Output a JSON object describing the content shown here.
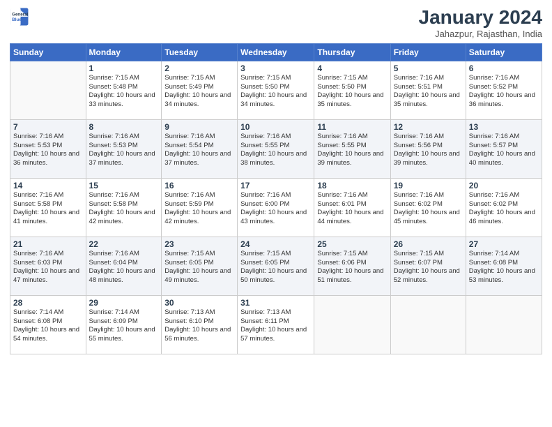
{
  "logo": {
    "line1": "General",
    "line2": "Blue"
  },
  "title": "January 2024",
  "location": "Jahazpur, Rajasthan, India",
  "weekdays": [
    "Sunday",
    "Monday",
    "Tuesday",
    "Wednesday",
    "Thursday",
    "Friday",
    "Saturday"
  ],
  "weeks": [
    [
      {
        "day": "",
        "sunrise": "",
        "sunset": "",
        "daylight": ""
      },
      {
        "day": "1",
        "sunrise": "Sunrise: 7:15 AM",
        "sunset": "Sunset: 5:48 PM",
        "daylight": "Daylight: 10 hours and 33 minutes."
      },
      {
        "day": "2",
        "sunrise": "Sunrise: 7:15 AM",
        "sunset": "Sunset: 5:49 PM",
        "daylight": "Daylight: 10 hours and 34 minutes."
      },
      {
        "day": "3",
        "sunrise": "Sunrise: 7:15 AM",
        "sunset": "Sunset: 5:50 PM",
        "daylight": "Daylight: 10 hours and 34 minutes."
      },
      {
        "day": "4",
        "sunrise": "Sunrise: 7:15 AM",
        "sunset": "Sunset: 5:50 PM",
        "daylight": "Daylight: 10 hours and 35 minutes."
      },
      {
        "day": "5",
        "sunrise": "Sunrise: 7:16 AM",
        "sunset": "Sunset: 5:51 PM",
        "daylight": "Daylight: 10 hours and 35 minutes."
      },
      {
        "day": "6",
        "sunrise": "Sunrise: 7:16 AM",
        "sunset": "Sunset: 5:52 PM",
        "daylight": "Daylight: 10 hours and 36 minutes."
      }
    ],
    [
      {
        "day": "7",
        "sunrise": "Sunrise: 7:16 AM",
        "sunset": "Sunset: 5:53 PM",
        "daylight": "Daylight: 10 hours and 36 minutes."
      },
      {
        "day": "8",
        "sunrise": "Sunrise: 7:16 AM",
        "sunset": "Sunset: 5:53 PM",
        "daylight": "Daylight: 10 hours and 37 minutes."
      },
      {
        "day": "9",
        "sunrise": "Sunrise: 7:16 AM",
        "sunset": "Sunset: 5:54 PM",
        "daylight": "Daylight: 10 hours and 37 minutes."
      },
      {
        "day": "10",
        "sunrise": "Sunrise: 7:16 AM",
        "sunset": "Sunset: 5:55 PM",
        "daylight": "Daylight: 10 hours and 38 minutes."
      },
      {
        "day": "11",
        "sunrise": "Sunrise: 7:16 AM",
        "sunset": "Sunset: 5:55 PM",
        "daylight": "Daylight: 10 hours and 39 minutes."
      },
      {
        "day": "12",
        "sunrise": "Sunrise: 7:16 AM",
        "sunset": "Sunset: 5:56 PM",
        "daylight": "Daylight: 10 hours and 39 minutes."
      },
      {
        "day": "13",
        "sunrise": "Sunrise: 7:16 AM",
        "sunset": "Sunset: 5:57 PM",
        "daylight": "Daylight: 10 hours and 40 minutes."
      }
    ],
    [
      {
        "day": "14",
        "sunrise": "Sunrise: 7:16 AM",
        "sunset": "Sunset: 5:58 PM",
        "daylight": "Daylight: 10 hours and 41 minutes."
      },
      {
        "day": "15",
        "sunrise": "Sunrise: 7:16 AM",
        "sunset": "Sunset: 5:58 PM",
        "daylight": "Daylight: 10 hours and 42 minutes."
      },
      {
        "day": "16",
        "sunrise": "Sunrise: 7:16 AM",
        "sunset": "Sunset: 5:59 PM",
        "daylight": "Daylight: 10 hours and 42 minutes."
      },
      {
        "day": "17",
        "sunrise": "Sunrise: 7:16 AM",
        "sunset": "Sunset: 6:00 PM",
        "daylight": "Daylight: 10 hours and 43 minutes."
      },
      {
        "day": "18",
        "sunrise": "Sunrise: 7:16 AM",
        "sunset": "Sunset: 6:01 PM",
        "daylight": "Daylight: 10 hours and 44 minutes."
      },
      {
        "day": "19",
        "sunrise": "Sunrise: 7:16 AM",
        "sunset": "Sunset: 6:02 PM",
        "daylight": "Daylight: 10 hours and 45 minutes."
      },
      {
        "day": "20",
        "sunrise": "Sunrise: 7:16 AM",
        "sunset": "Sunset: 6:02 PM",
        "daylight": "Daylight: 10 hours and 46 minutes."
      }
    ],
    [
      {
        "day": "21",
        "sunrise": "Sunrise: 7:16 AM",
        "sunset": "Sunset: 6:03 PM",
        "daylight": "Daylight: 10 hours and 47 minutes."
      },
      {
        "day": "22",
        "sunrise": "Sunrise: 7:16 AM",
        "sunset": "Sunset: 6:04 PM",
        "daylight": "Daylight: 10 hours and 48 minutes."
      },
      {
        "day": "23",
        "sunrise": "Sunrise: 7:15 AM",
        "sunset": "Sunset: 6:05 PM",
        "daylight": "Daylight: 10 hours and 49 minutes."
      },
      {
        "day": "24",
        "sunrise": "Sunrise: 7:15 AM",
        "sunset": "Sunset: 6:05 PM",
        "daylight": "Daylight: 10 hours and 50 minutes."
      },
      {
        "day": "25",
        "sunrise": "Sunrise: 7:15 AM",
        "sunset": "Sunset: 6:06 PM",
        "daylight": "Daylight: 10 hours and 51 minutes."
      },
      {
        "day": "26",
        "sunrise": "Sunrise: 7:15 AM",
        "sunset": "Sunset: 6:07 PM",
        "daylight": "Daylight: 10 hours and 52 minutes."
      },
      {
        "day": "27",
        "sunrise": "Sunrise: 7:14 AM",
        "sunset": "Sunset: 6:08 PM",
        "daylight": "Daylight: 10 hours and 53 minutes."
      }
    ],
    [
      {
        "day": "28",
        "sunrise": "Sunrise: 7:14 AM",
        "sunset": "Sunset: 6:08 PM",
        "daylight": "Daylight: 10 hours and 54 minutes."
      },
      {
        "day": "29",
        "sunrise": "Sunrise: 7:14 AM",
        "sunset": "Sunset: 6:09 PM",
        "daylight": "Daylight: 10 hours and 55 minutes."
      },
      {
        "day": "30",
        "sunrise": "Sunrise: 7:13 AM",
        "sunset": "Sunset: 6:10 PM",
        "daylight": "Daylight: 10 hours and 56 minutes."
      },
      {
        "day": "31",
        "sunrise": "Sunrise: 7:13 AM",
        "sunset": "Sunset: 6:11 PM",
        "daylight": "Daylight: 10 hours and 57 minutes."
      },
      {
        "day": "",
        "sunrise": "",
        "sunset": "",
        "daylight": ""
      },
      {
        "day": "",
        "sunrise": "",
        "sunset": "",
        "daylight": ""
      },
      {
        "day": "",
        "sunrise": "",
        "sunset": "",
        "daylight": ""
      }
    ]
  ]
}
